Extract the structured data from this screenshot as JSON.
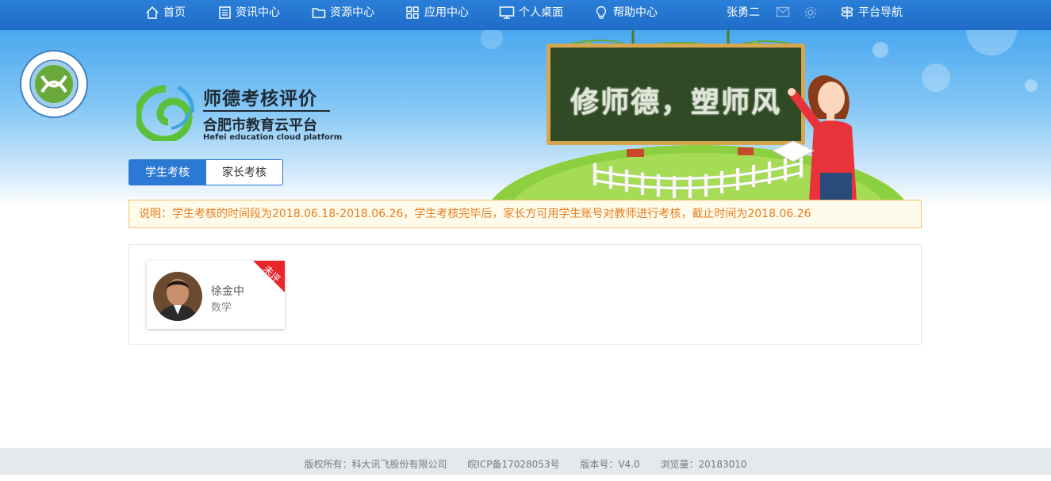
{
  "nav": {
    "items": [
      {
        "label": "首页",
        "icon": "home-icon"
      },
      {
        "label": "资讯中心",
        "icon": "news-icon"
      },
      {
        "label": "资源中心",
        "icon": "folder-icon"
      },
      {
        "label": "应用中心",
        "icon": "apps-grid-icon"
      },
      {
        "label": "个人桌面",
        "icon": "monitor-icon"
      },
      {
        "label": "帮助中心",
        "icon": "lightbulb-icon"
      }
    ],
    "user_name": "张勇二",
    "platform_nav_label": "平台导航"
  },
  "brand": {
    "title": "师德考核评价",
    "subtitle": "合肥市教育云平台",
    "english": "Hefei education cloud platform",
    "slogan": "修师德，塑师风"
  },
  "tabs": [
    {
      "label": "学生考核",
      "active": true
    },
    {
      "label": "家长考核",
      "active": false
    }
  ],
  "notice": "说明：学生考核的时间段为2018.06.18-2018.06.26，学生考核完毕后，家长方可用学生账号对教师进行考核，截止时间为2018.06.26",
  "teachers": [
    {
      "name": "徐金中",
      "subject": "数学",
      "status": "未评"
    }
  ],
  "footer": {
    "copyright": "版权所有：科大讯飞股份有限公司",
    "icp": "皖ICP备17028053号",
    "version": "版本号：V4.0",
    "views": "浏览量：20183010"
  },
  "colors": {
    "nav_bg": "#2277d4",
    "accent": "#2c79d4",
    "notice_text": "#e67e22",
    "ribbon": "#e8262c"
  }
}
